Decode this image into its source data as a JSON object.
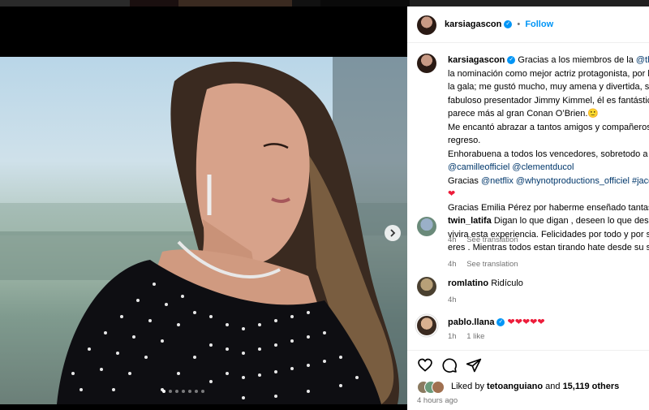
{
  "post": {
    "author": "karsiagascon",
    "follow_label": "Follow",
    "caption_lines": [
      [
        "Gracias a los miembros de la ",
        "@theac"
      ],
      [
        "la nominación como mejor actriz protagonista, por la",
        ""
      ],
      [
        "la gala; me gustó mucho, muy amena y divertida, sob",
        ""
      ],
      [
        "fabuloso presentador Jimmy Kimmel, él es fantástico,",
        ""
      ],
      [
        "parece más al gran Conan O’Brien.🙂",
        ""
      ],
      [
        "Me encantó abrazar a tantos amigos y compañeros e",
        ""
      ],
      [
        "regreso.",
        ""
      ],
      [
        "Enhorabuena a todos los vencedores, sobretodo a ",
        "@"
      ],
      [
        "",
        "@camilleofficiel @clementducol"
      ],
      [
        "Gracias ",
        "@netflix @whynotproductions_officiel #jacqu"
      ],
      [
        "❤",
        ""
      ],
      [
        "Gracias Emilia Pérez por haberme enseñado tantas co",
        ""
      ]
    ],
    "caption_time": "4h",
    "see_translation": "See translation"
  },
  "comments": [
    {
      "user": "twin_latifa",
      "lines": [
        "Digan lo que digan , deseen lo que deseen",
        "vivira esta experiencia. Felicidades por todo y por ser",
        "eres . Mientras todos estan tirando hate desde su sillo"
      ],
      "time": "4h",
      "see_translation": "See translation"
    },
    {
      "user": "romlatino",
      "text": "Ridículo",
      "time": "4h"
    },
    {
      "user": "pablo.llana",
      "hearts": "❤❤❤❤❤",
      "time": "1h",
      "likes": "1 like"
    }
  ],
  "footer": {
    "liked_by_prefix": "Liked by ",
    "liked_by_user": "tetoanguiano",
    "and": " and ",
    "others": "15,119 others",
    "posted_ago": "4 hours ago"
  },
  "icons": {
    "verified": "verified-badge-icon",
    "next": "chevron-right-icon",
    "like": "heart-outline-icon",
    "comment": "comment-bubble-icon",
    "share": "paper-plane-icon"
  },
  "colors": {
    "accent": "#0095f6",
    "link": "#00376b",
    "meta": "#737373",
    "heart": "#ed1c3a"
  },
  "carousel": {
    "slides": 7,
    "active_index": 0
  }
}
